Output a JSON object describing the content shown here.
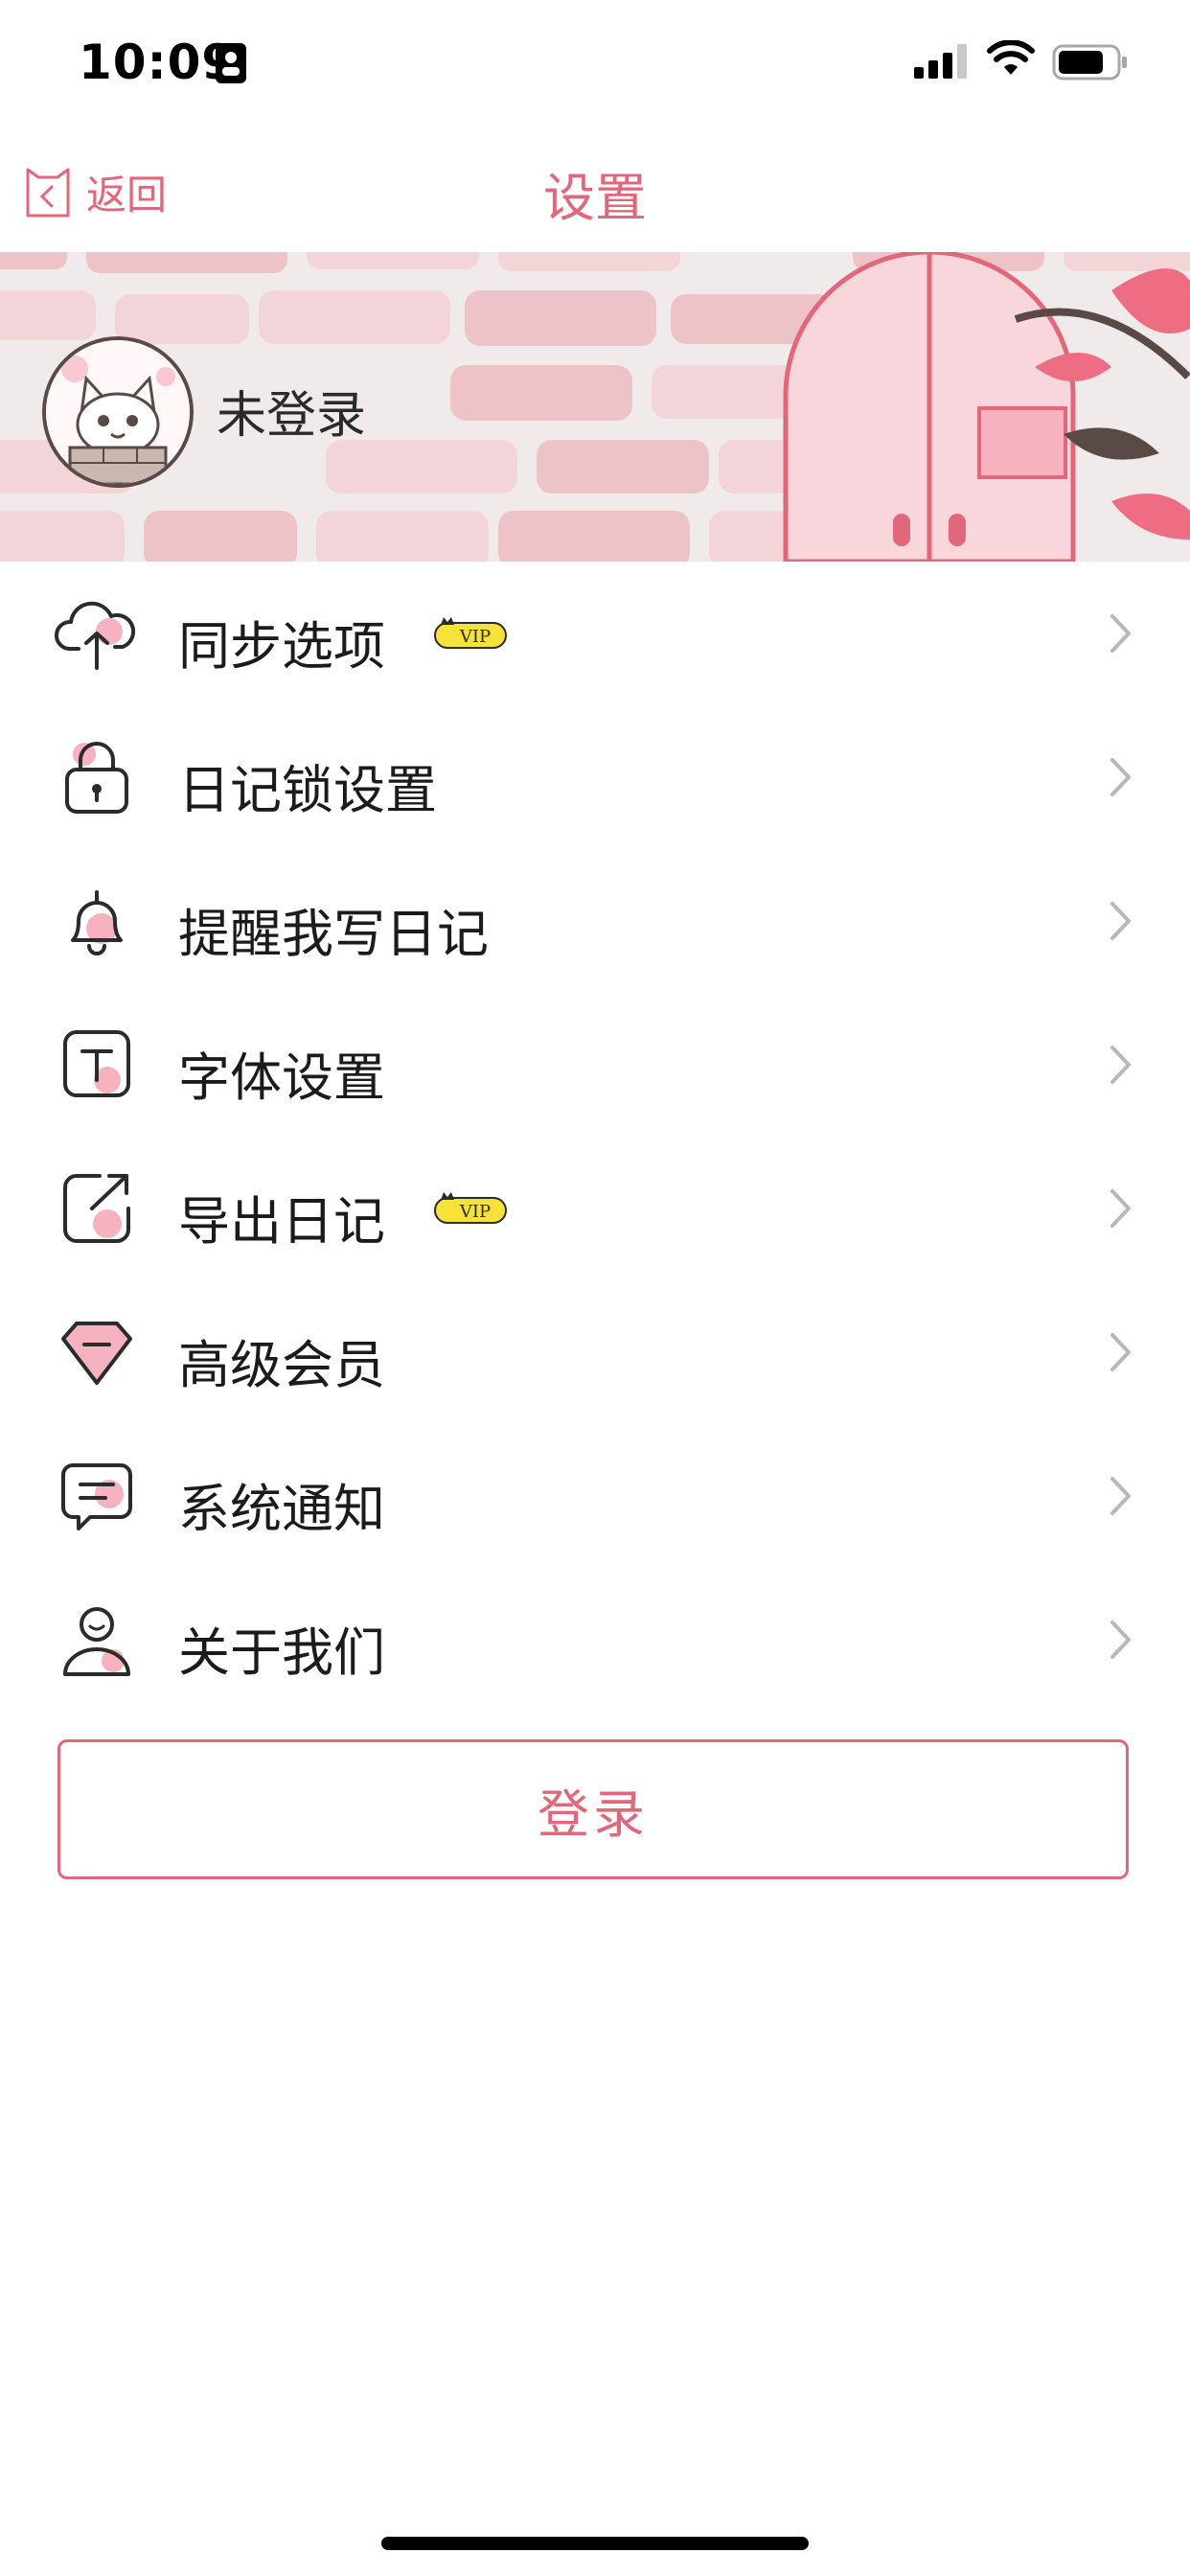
{
  "status_bar": {
    "time": "10:09"
  },
  "nav": {
    "back_label": "返回",
    "title": "设置"
  },
  "profile": {
    "name": "未登录"
  },
  "menu": [
    {
      "label": "同步选项",
      "icon": "cloud-upload-icon",
      "vip": true
    },
    {
      "label": "日记锁设置",
      "icon": "lock-icon",
      "vip": false
    },
    {
      "label": "提醒我写日记",
      "icon": "bell-icon",
      "vip": false
    },
    {
      "label": "字体设置",
      "icon": "font-icon",
      "vip": false
    },
    {
      "label": "导出日记",
      "icon": "export-icon",
      "vip": true
    },
    {
      "label": "高级会员",
      "icon": "diamond-icon",
      "vip": false
    },
    {
      "label": "系统通知",
      "icon": "message-icon",
      "vip": false
    },
    {
      "label": "关于我们",
      "icon": "person-icon",
      "vip": false
    }
  ],
  "vip_badge": "VIP",
  "login_button": "登录",
  "colors": {
    "accent": "#e0687a",
    "pink_fill": "#f6b3bf",
    "badge": "#f7e23a"
  }
}
